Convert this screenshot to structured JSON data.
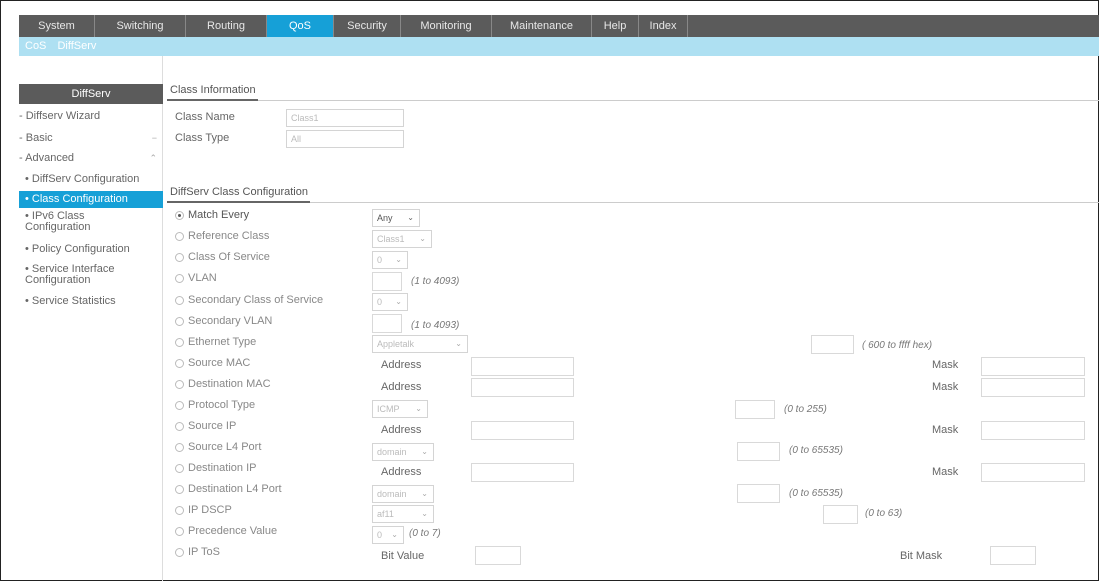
{
  "top_nav": {
    "tabs": [
      "System",
      "Switching",
      "Routing",
      "QoS",
      "Security",
      "Monitoring",
      "Maintenance",
      "Help",
      "Index"
    ],
    "active": "QoS"
  },
  "sub_nav": {
    "items": [
      "CoS",
      "DiffServ"
    ]
  },
  "sidebar": {
    "header": "DiffServ",
    "items": [
      "Diffserv Wizard",
      "Basic",
      "Advanced",
      "DiffServ Configuration",
      "Class Configuration",
      "IPv6 Class Configuration",
      "Policy Configuration",
      "Service Interface Configuration",
      "Service Statistics"
    ],
    "selected": "Class Configuration"
  },
  "class_info": {
    "title": "Class Information",
    "name_label": "Class Name",
    "name_value": "Class1",
    "type_label": "Class Type",
    "type_value": "All"
  },
  "diffserv_config": {
    "title": "DiffServ Class Configuration",
    "rows": {
      "match_every": {
        "label": "Match Every",
        "select": "Any"
      },
      "reference_class": {
        "label": "Reference Class",
        "select": "Class1"
      },
      "class_of_service": {
        "label": "Class Of Service",
        "select": "0"
      },
      "vlan": {
        "label": "VLAN",
        "hint": "(1 to 4093)"
      },
      "secondary_cos": {
        "label": "Secondary Class of Service",
        "select": "0"
      },
      "secondary_vlan": {
        "label": "Secondary VLAN",
        "hint": "(1 to 4093)"
      },
      "ethernet_type": {
        "label": "Ethernet Type",
        "select": "Appletalk",
        "hint": "( 600 to ffff hex)"
      },
      "source_mac": {
        "label": "Source MAC",
        "address": "Address",
        "mask": "Mask"
      },
      "destination_mac": {
        "label": "Destination MAC",
        "address": "Address",
        "mask": "Mask"
      },
      "protocol_type": {
        "label": "Protocol Type",
        "select": "ICMP",
        "hint": "(0 to 255)"
      },
      "source_ip": {
        "label": "Source IP",
        "address": "Address",
        "mask": "Mask"
      },
      "source_l4_port": {
        "label": "Source L4 Port",
        "select": "domain",
        "hint": "(0 to 65535)"
      },
      "destination_ip": {
        "label": "Destination IP",
        "address": "Address",
        "mask": "Mask"
      },
      "destination_l4_port": {
        "label": "Destination L4 Port",
        "select": "domain",
        "hint": "(0 to 65535)"
      },
      "ip_dscp": {
        "label": "IP DSCP",
        "select": "af11",
        "hint": "(0 to 63)"
      },
      "precedence_value": {
        "label": "Precedence Value",
        "select": "0",
        "hint": "(0 to 7)"
      },
      "ip_tos": {
        "label": "IP ToS",
        "bit_value": "Bit Value",
        "bit_mask": "Bit Mask"
      }
    },
    "selected_option": "match_every"
  },
  "colors": {
    "nav_bg": "#5b5b5b",
    "accent": "#16a0d7",
    "subnav_bg": "#aee0f2"
  },
  "icons": {
    "caret": "chevron-down-icon",
    "expand": "expand-arrow-icon"
  }
}
